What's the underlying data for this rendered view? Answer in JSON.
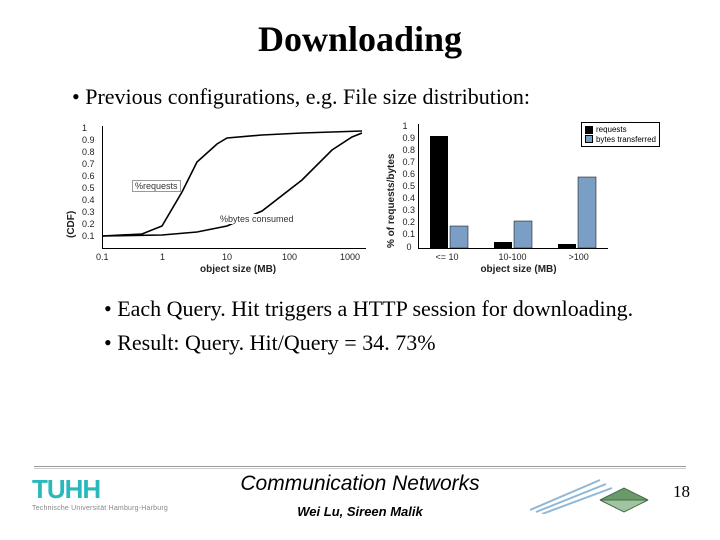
{
  "title": "Downloading",
  "bullets": {
    "b1": "Previous configurations, e.g. File size distribution:",
    "b2": "Each Query. Hit triggers a HTTP session for downloading.",
    "b3": "Result: Query. Hit/Query = 34. 73%"
  },
  "footer": {
    "course": "Communication Networks",
    "authors": "Wei Lu, Sireen Malik",
    "page": "18",
    "logo_main": "TUHH",
    "logo_sub": "Technische Universität Hamburg-Harburg"
  },
  "chart_data": [
    {
      "type": "line",
      "title": "",
      "xlabel": "object size (MB)",
      "ylabel": "(CDF)",
      "xscale": "log",
      "xticks": [
        0.1,
        1,
        10,
        100,
        1000
      ],
      "yticks": [
        0.1,
        0.2,
        0.3,
        0.4,
        0.5,
        0.6,
        0.7,
        0.8,
        0.9,
        1
      ],
      "annotations": [
        "%requests",
        "%bytes consumed"
      ],
      "series": [
        {
          "name": "%requests",
          "x": [
            0.1,
            0.5,
            1,
            2,
            3,
            5,
            10,
            30,
            100,
            1000
          ],
          "y": [
            0.1,
            0.12,
            0.18,
            0.45,
            0.7,
            0.85,
            0.9,
            0.93,
            0.95,
            0.97
          ]
        },
        {
          "name": "%bytes consumed",
          "x": [
            0.1,
            1,
            3,
            10,
            30,
            100,
            300,
            700,
            1000
          ],
          "y": [
            0.1,
            0.11,
            0.13,
            0.18,
            0.3,
            0.55,
            0.8,
            0.92,
            0.95
          ]
        }
      ]
    },
    {
      "type": "bar",
      "title": "",
      "xlabel": "object size (MB)",
      "ylabel": "% of requests/bytes",
      "categories": [
        "<= 10",
        "10-100",
        ">100"
      ],
      "yticks": [
        0,
        0.1,
        0.2,
        0.3,
        0.4,
        0.5,
        0.6,
        0.7,
        0.8,
        0.9,
        1
      ],
      "series": [
        {
          "name": "requests",
          "values": [
            0.9,
            0.05,
            0.03
          ]
        },
        {
          "name": "bytes transferred",
          "values": [
            0.18,
            0.22,
            0.57
          ]
        }
      ],
      "legend": [
        "requests",
        "bytes transferred"
      ]
    }
  ]
}
